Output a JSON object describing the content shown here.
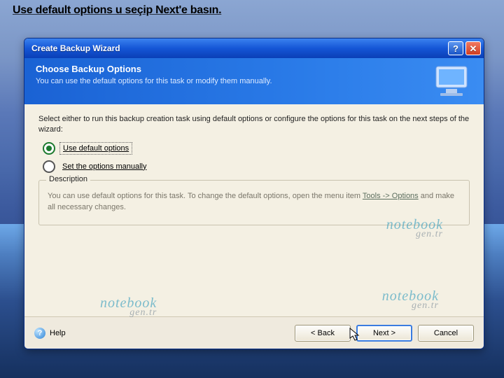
{
  "caption": "Use default options u seçip Next'e basın.",
  "titlebar": {
    "title": "Create Backup Wizard"
  },
  "header": {
    "title": "Choose Backup Options",
    "subtitle": "You can use the default options for this task or modify them manually."
  },
  "instruction": "Select either to run this backup creation task using default options or configure the options for this task on the next steps of the wizard:",
  "options": {
    "use_default": "Use default options",
    "set_manually": "Set the options manually"
  },
  "description": {
    "legend": "Description",
    "body_pre": "You can use default options for this task. To change the default options, open the menu item ",
    "body_link": "Tools -> Options",
    "body_post": " and make all necessary changes."
  },
  "watermark": {
    "line1": "notebook",
    "line2": "gen.tr"
  },
  "footer": {
    "help": "Help",
    "back": "< Back",
    "next": "Next >",
    "cancel": "Cancel"
  }
}
